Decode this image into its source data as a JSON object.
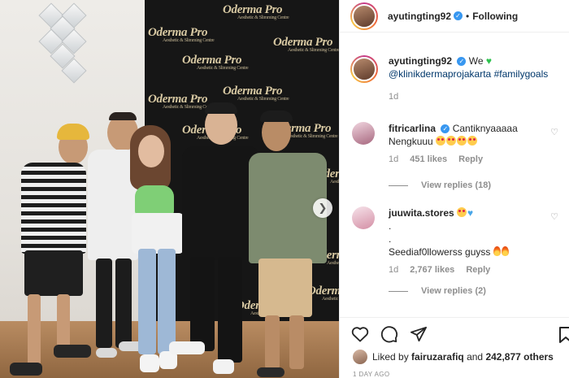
{
  "photo": {
    "logo_text": "Oderma Pro",
    "logo_subtext": "Aesthetic & Slimming Centre",
    "next_icon": "chevron-right-icon"
  },
  "header": {
    "username": "ayutingting92",
    "separator": "•",
    "follow_state": "Following"
  },
  "caption": {
    "username": "ayutingting92",
    "text": "We",
    "emoji": "green-heart",
    "tags": "@klinikdermaprojakarta #familygoals",
    "time": "1d"
  },
  "comments": [
    {
      "username": "fitricarlina",
      "verified": true,
      "text": "Cantiknyaaaaa Nengkuuu",
      "emoji_count": 4,
      "time": "1d",
      "likes": "451 likes",
      "reply_label": "Reply",
      "view_replies": "View replies (18)"
    },
    {
      "username": "juuwita.stores",
      "verified": false,
      "line1": ".",
      "line2": ".",
      "line3": "Seediaf0llowerss guyss",
      "time": "1d",
      "likes": "2,767 likes",
      "reply_label": "Reply",
      "view_replies": "View replies (2)"
    }
  ],
  "actions": {
    "liked_prefix": "Liked by",
    "liked_user": "fairuzarafiq",
    "liked_and": "and",
    "liked_others": "242,877 others",
    "timestamp": "1 DAY AGO"
  },
  "colors": {
    "link": "#00376b",
    "meta": "#8e8e8e",
    "verified": "#3897f0",
    "green_heart": "#2ec24e"
  }
}
